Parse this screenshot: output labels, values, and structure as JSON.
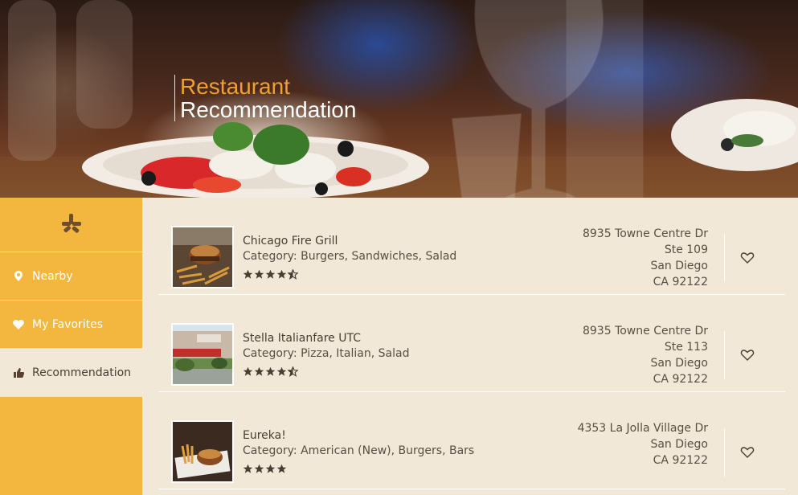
{
  "header": {
    "title_accent": "Restaurant",
    "title_main": "Recommendation"
  },
  "sidebar": {
    "logo_icon": "yelp-burst-icon",
    "items": [
      {
        "label": "Nearby",
        "icon": "map-pin-icon",
        "active": false
      },
      {
        "label": "My Favorites",
        "icon": "heart-icon",
        "active": false
      },
      {
        "label": "Recommendation",
        "icon": "thumbs-up-icon",
        "active": true
      }
    ]
  },
  "restaurants": [
    {
      "name": "Chicago Fire Grill",
      "category": "Category: Burgers, Sandwiches, Salad",
      "rating": 4.5,
      "address": [
        "8935 Towne Centre Dr",
        "Ste 109",
        "San Diego",
        "CA 92122"
      ]
    },
    {
      "name": "Stella Italianfare UTC",
      "category": "Category: Pizza, Italian, Salad",
      "rating": 4.5,
      "address": [
        "8935 Towne Centre Dr",
        "Ste 113",
        "San Diego",
        "CA 92122"
      ]
    },
    {
      "name": "Eureka!",
      "category": "Category: American (New), Burgers, Bars",
      "rating": 4,
      "address": [
        "4353 La Jolla Village Dr",
        "San Diego",
        "CA 92122"
      ]
    }
  ],
  "colors": {
    "accent_orange": "#f0a030",
    "sidebar_yellow": "#f3b740",
    "content_bg": "#f1e8d8",
    "text_brown": "#4a3d33"
  }
}
